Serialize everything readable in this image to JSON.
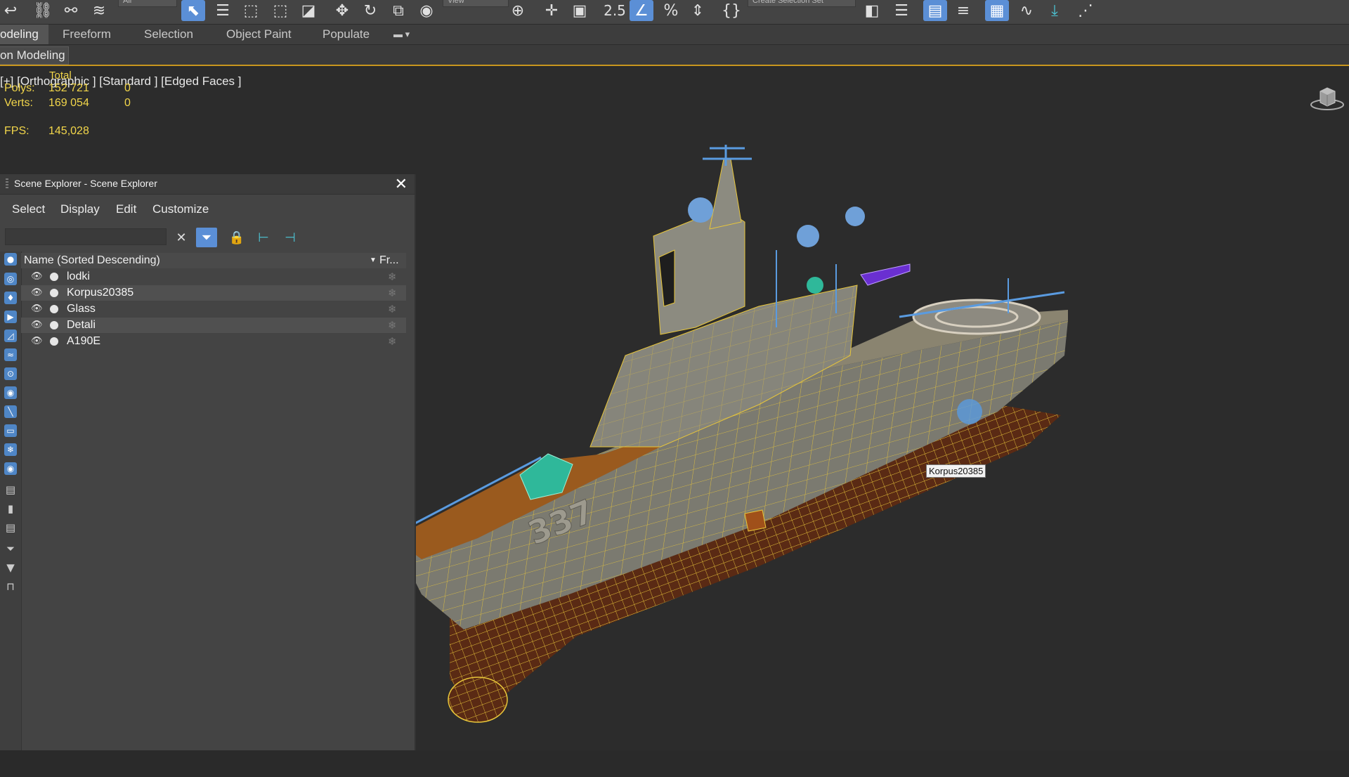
{
  "toolbar": {
    "selection_filter": "All",
    "ref_coord": "View",
    "selection_set": "Create Selection Set",
    "snap_label": "2.5",
    "percent_snap": "%",
    "icons": [
      "undo-icon",
      "link-icon",
      "unlink-icon",
      "bind-space-warp-icon",
      "select-object-icon",
      "select-by-name-icon",
      "rect-region-icon",
      "window-crossing-icon",
      "select-move-icon",
      "select-rotate-icon",
      "select-scale-icon",
      "select-place-icon",
      "use-pivot-icon",
      "snap-toggle-icon",
      "angle-snap-icon",
      "percent-snap-icon",
      "spinner-snap-icon",
      "edit-named-sets-icon",
      "mirror-icon",
      "align-icon",
      "toggle-scene-explorer-icon",
      "toggle-layer-explorer-icon",
      "toggle-ribbon-icon",
      "curve-editor-icon",
      "render-setup-icon"
    ]
  },
  "ribbon": {
    "tabs": [
      {
        "label": "odeling",
        "active": true
      },
      {
        "label": "Freeform",
        "active": false
      },
      {
        "label": "Selection",
        "active": false
      },
      {
        "label": "Object Paint",
        "active": false
      },
      {
        "label": "Populate",
        "active": false
      }
    ],
    "sub_tab": "on Modeling"
  },
  "viewport": {
    "label": "[+] [Orthographic ] [Standard ] [Edged Faces ]",
    "stats": {
      "total_label": "Total",
      "polys_label": "Polys:",
      "polys_value": "152 721",
      "polys_sel": "0",
      "verts_label": "Verts:",
      "verts_value": "169 054",
      "verts_sel": "0",
      "fps_label": "FPS:",
      "fps_value": "145,028"
    },
    "hull_number": "337",
    "tooltip": "Korpus20385",
    "colors": {
      "wire": "#e8c63a",
      "helper_blue": "#5a9be0",
      "hull": "#7b7a70",
      "deck": "#9a5a1e",
      "underwater": "#5a2a14",
      "boat": "#6a2fd1",
      "green_part": "#2fb89a"
    }
  },
  "scene_explorer": {
    "title": "Scene Explorer - Scene Explorer",
    "menu": [
      "Select",
      "Display",
      "Edit",
      "Customize"
    ],
    "search_placeholder": "",
    "column_name": "Name (Sorted Descending)",
    "column_frozen": "Fr...",
    "rows": [
      {
        "name": "lodki"
      },
      {
        "name": "Korpus20385"
      },
      {
        "name": "Glass"
      },
      {
        "name": "Detali"
      },
      {
        "name": "A190E"
      }
    ],
    "side_icons": [
      "geometry-filter-icon",
      "shape-filter-icon",
      "light-filter-icon",
      "camera-filter-icon",
      "helper-filter-icon",
      "spacewarp-filter-icon",
      "group-filter-icon",
      "xref-filter-icon",
      "bone-filter-icon",
      "container-filter-icon",
      "frozen-filter-icon",
      "hidden-filter-icon",
      "display-all-icon",
      "display-none-icon",
      "invert-display-icon",
      "filter-icon",
      "funnel-icon",
      "container-icon"
    ]
  }
}
